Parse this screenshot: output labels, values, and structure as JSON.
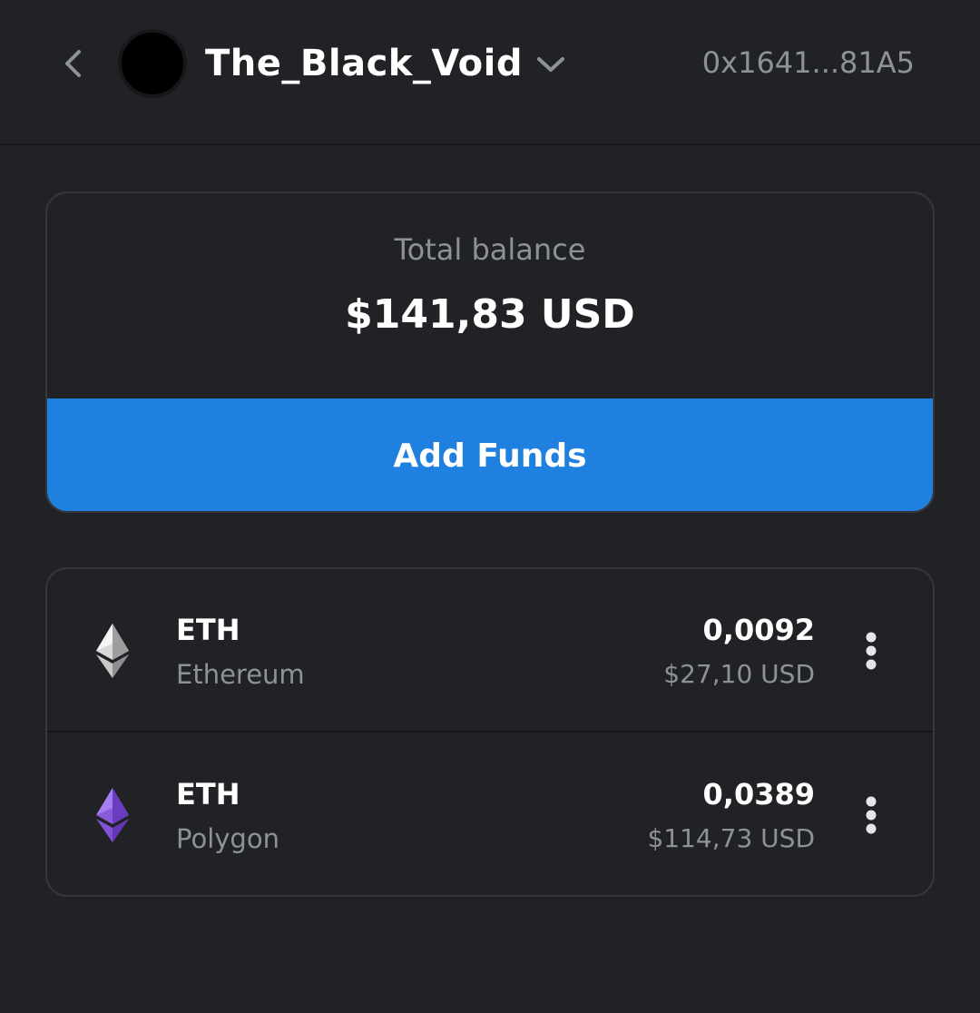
{
  "header": {
    "wallet_name": "The_Black_Void",
    "address": "0x1641...81A5"
  },
  "balance": {
    "label": "Total balance",
    "value": "$141,83 USD",
    "add_funds_label": "Add Funds",
    "accent_color": "#1f80e0"
  },
  "tokens": [
    {
      "symbol": "ETH",
      "network": "Ethereum",
      "amount": "0,0092",
      "fiat": "$27,10 USD",
      "icon": "ethereum-icon"
    },
    {
      "symbol": "ETH",
      "network": "Polygon",
      "amount": "0,0389",
      "fiat": "$114,73 USD",
      "icon": "polygon-eth-icon"
    }
  ]
}
